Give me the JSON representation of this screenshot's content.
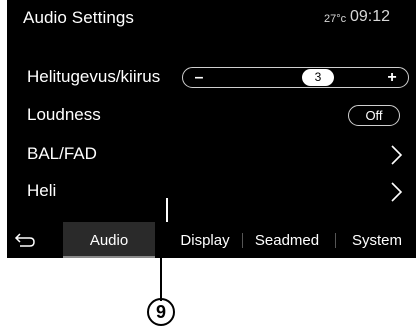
{
  "header": {
    "title": "Audio Settings",
    "temperature": "27°c",
    "time": "09:12"
  },
  "rows": {
    "volume": {
      "label": "Helitugevus/kiirus",
      "minus": "–",
      "plus": "+",
      "value": "3"
    },
    "loudness": {
      "label": "Loudness",
      "toggle_value": "Off"
    },
    "balfad": {
      "label": "BAL/FAD"
    },
    "sound": {
      "label": "Heli"
    }
  },
  "tabs": {
    "back_icon": "back-arrow-icon",
    "items": [
      {
        "label": "Audio",
        "active": true
      },
      {
        "label": "Display",
        "active": false
      },
      {
        "label": "Seadmed",
        "active": false
      },
      {
        "label": "System",
        "active": false
      }
    ]
  },
  "callout": {
    "number": "9"
  }
}
